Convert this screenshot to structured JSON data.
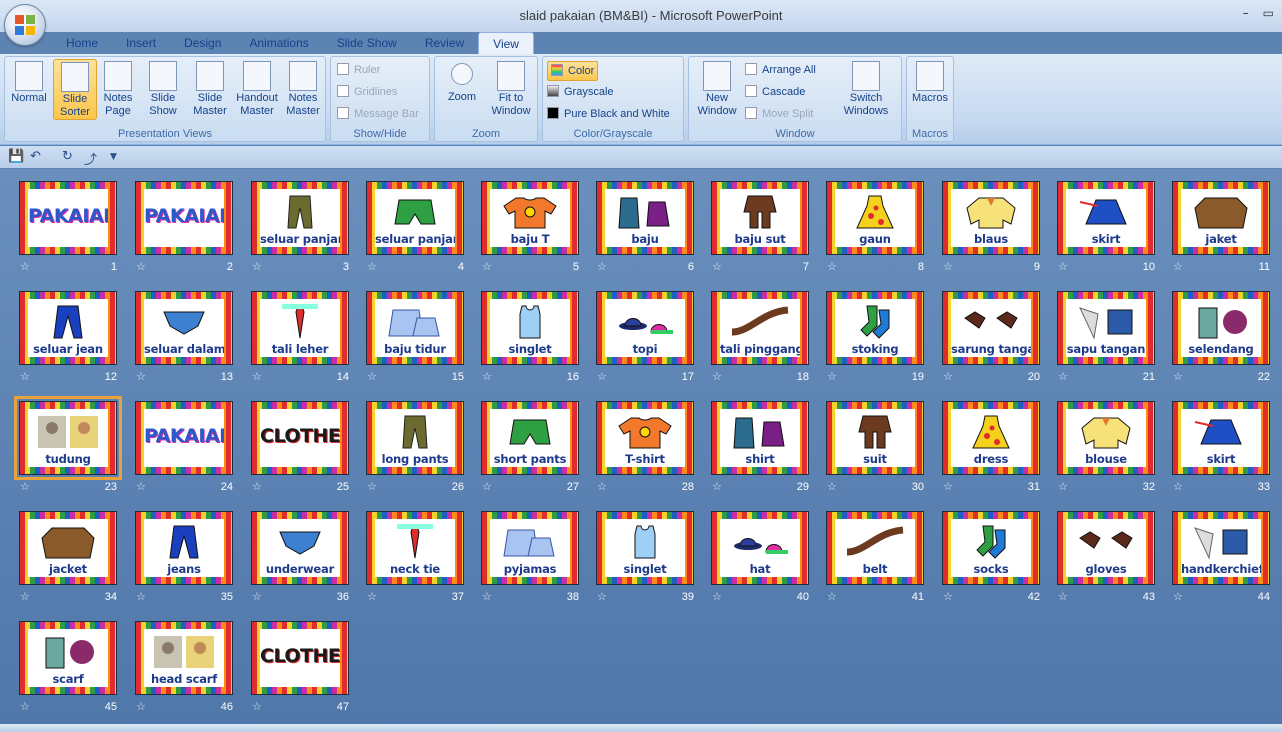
{
  "window": {
    "title": "slaid pakaian (BM&BI) - Microsoft PowerPoint",
    "controls": [
      "–",
      "▭"
    ]
  },
  "tabs": [
    "Home",
    "Insert",
    "Design",
    "Animations",
    "Slide Show",
    "Review",
    "View"
  ],
  "active_tab": "View",
  "ribbon": {
    "presentation_views": {
      "label": "Presentation Views",
      "buttons": [
        "Normal",
        "Slide Sorter",
        "Notes Page",
        "Slide Show",
        "Slide Master",
        "Handout Master",
        "Notes Master"
      ]
    },
    "show_hide": {
      "label": "Show/Hide",
      "items": [
        "Ruler",
        "Gridlines",
        "Message Bar"
      ]
    },
    "zoom": {
      "label": "Zoom",
      "buttons": [
        "Zoom",
        "Fit to Window"
      ]
    },
    "color": {
      "label": "Color/Grayscale",
      "items": [
        "Color",
        "Grayscale",
        "Pure Black and White"
      ]
    },
    "window": {
      "label": "Window",
      "new_window": "New Window",
      "items": [
        "Arrange All",
        "Cascade",
        "Move Split"
      ],
      "switch": "Switch Windows"
    },
    "macros": {
      "label": "Macros",
      "button": "Macros"
    }
  },
  "colors": {
    "accent": "#e8a33d",
    "caption": "#1e3a8a",
    "background": "#5d83b2"
  },
  "slides": [
    {
      "n": "1",
      "cap": "",
      "big": "PAKAIAN",
      "type": "title"
    },
    {
      "n": "2",
      "cap": "",
      "big": "PAKAIAN",
      "type": "title"
    },
    {
      "n": "3",
      "cap": "seluar panjang",
      "icon": "pants"
    },
    {
      "n": "4",
      "cap": "seluar panjang",
      "icon": "shorts"
    },
    {
      "n": "5",
      "cap": "baju T",
      "icon": "tshirt"
    },
    {
      "n": "6",
      "cap": "baju",
      "icon": "shirt"
    },
    {
      "n": "7",
      "cap": "baju sut",
      "icon": "suit"
    },
    {
      "n": "8",
      "cap": "gaun",
      "icon": "dress"
    },
    {
      "n": "9",
      "cap": "blaus",
      "icon": "blouse"
    },
    {
      "n": "10",
      "cap": "skirt",
      "icon": "skirt"
    },
    {
      "n": "11",
      "cap": "jaket",
      "icon": "jacket"
    },
    {
      "n": "12",
      "cap": "seluar jean",
      "icon": "jeans"
    },
    {
      "n": "13",
      "cap": "seluar dalam",
      "icon": "underwear"
    },
    {
      "n": "14",
      "cap": "tali leher",
      "icon": "tie"
    },
    {
      "n": "15",
      "cap": "baju tidur",
      "icon": "pyjamas"
    },
    {
      "n": "16",
      "cap": "singlet",
      "icon": "singlet"
    },
    {
      "n": "17",
      "cap": "topi",
      "icon": "hat"
    },
    {
      "n": "18",
      "cap": "tali pinggang",
      "icon": "belt"
    },
    {
      "n": "19",
      "cap": "stoking",
      "icon": "socks"
    },
    {
      "n": "20",
      "cap": "sarung tangan",
      "icon": "gloves"
    },
    {
      "n": "21",
      "cap": "sapu tangan",
      "icon": "handkerchief"
    },
    {
      "n": "22",
      "cap": "selendang",
      "icon": "scarf"
    },
    {
      "n": "23",
      "cap": "tudung",
      "icon": "photo",
      "selected": true
    },
    {
      "n": "24",
      "cap": "",
      "big": "PAKAIAN",
      "type": "title"
    },
    {
      "n": "25",
      "cap": "",
      "big": "CLOTHES",
      "type": "title"
    },
    {
      "n": "26",
      "cap": "long pants",
      "icon": "pants"
    },
    {
      "n": "27",
      "cap": "short pants",
      "icon": "shorts"
    },
    {
      "n": "28",
      "cap": "T-shirt",
      "icon": "tshirt"
    },
    {
      "n": "29",
      "cap": "shirt",
      "icon": "shirt"
    },
    {
      "n": "30",
      "cap": "suit",
      "icon": "suit"
    },
    {
      "n": "31",
      "cap": "dress",
      "icon": "dress"
    },
    {
      "n": "32",
      "cap": "blouse",
      "icon": "blouse"
    },
    {
      "n": "33",
      "cap": "skirt",
      "icon": "skirt"
    },
    {
      "n": "34",
      "cap": "jacket",
      "icon": "jacket"
    },
    {
      "n": "35",
      "cap": "jeans",
      "icon": "jeans"
    },
    {
      "n": "36",
      "cap": "underwear",
      "icon": "underwear"
    },
    {
      "n": "37",
      "cap": "neck tie",
      "icon": "tie"
    },
    {
      "n": "38",
      "cap": "pyjamas",
      "icon": "pyjamas"
    },
    {
      "n": "39",
      "cap": "singlet",
      "icon": "singlet"
    },
    {
      "n": "40",
      "cap": "hat",
      "icon": "hat"
    },
    {
      "n": "41",
      "cap": "belt",
      "icon": "belt"
    },
    {
      "n": "42",
      "cap": "socks",
      "icon": "socks"
    },
    {
      "n": "43",
      "cap": "gloves",
      "icon": "gloves"
    },
    {
      "n": "44",
      "cap": "handkerchief",
      "icon": "handkerchief"
    },
    {
      "n": "45",
      "cap": "scarf",
      "icon": "scarf"
    },
    {
      "n": "46",
      "cap": "head scarf",
      "icon": "photo"
    },
    {
      "n": "47",
      "cap": "",
      "big": "CLOTHES",
      "type": "title"
    }
  ]
}
